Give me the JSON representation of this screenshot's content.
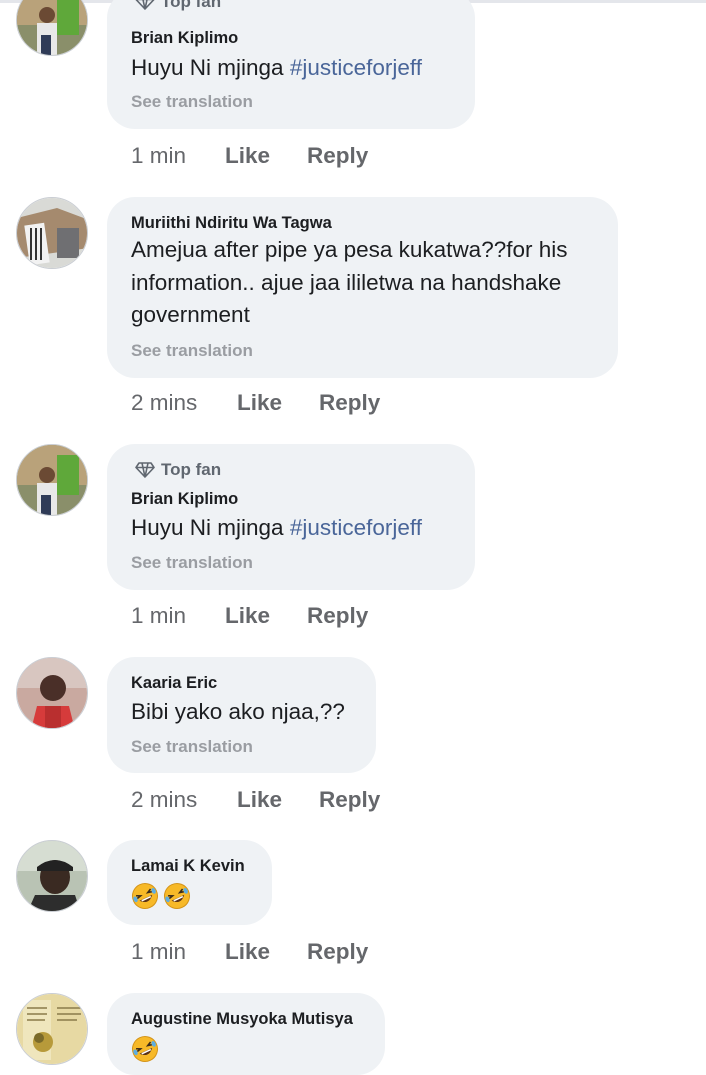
{
  "comments": [
    {
      "top_fan": "Top fan",
      "author": "Brian Kiplimo",
      "text": "Huyu Ni mjinga ",
      "hashtag": "#justiceforjeff",
      "see_translation": "See translation",
      "time": "1 min",
      "like": "Like",
      "reply": "Reply"
    },
    {
      "author": "Muriithi Ndiritu Wa Tagwa",
      "lines": [
        "Amejua after pipe ya pesa kukatwa??for his",
        "information.. ajue jaa ililetwa na handshake",
        "government"
      ],
      "see_translation": "See translation",
      "time": "2 mins",
      "like": "Like",
      "reply": "Reply"
    },
    {
      "top_fan": "Top fan",
      "author": "Brian Kiplimo",
      "text": "Huyu Ni mjinga ",
      "hashtag": "#justiceforjeff",
      "see_translation": "See translation",
      "time": "1 min",
      "like": "Like",
      "reply": "Reply"
    },
    {
      "author": "Kaaria Eric",
      "text": "Bibi yako ako njaa,??",
      "see_translation": "See translation",
      "time": "2 mins",
      "like": "Like",
      "reply": "Reply"
    },
    {
      "author": "Lamai K Kevin",
      "emojis": [
        "rolling-laughing-emoji",
        "rolling-laughing-emoji"
      ],
      "time": "1 min",
      "like": "Like",
      "reply": "Reply"
    },
    {
      "author": "Augustine Musyoka Mutisya",
      "emojis": [
        "rolling-laughing-emoji"
      ]
    }
  ],
  "colors": {
    "bubble": "#eff2f5",
    "hashtag": "#4a6699",
    "meta": "#65676b",
    "emoji": "#f7b928"
  }
}
